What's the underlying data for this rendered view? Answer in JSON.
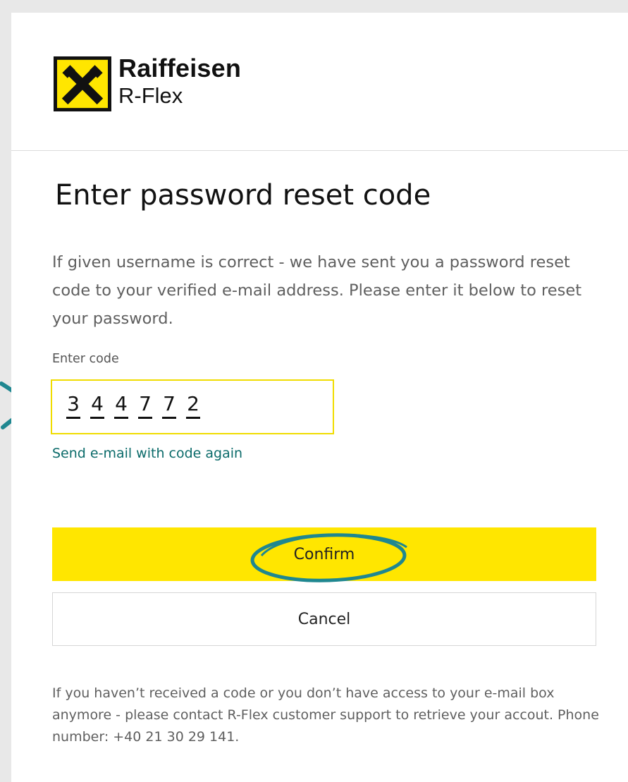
{
  "brand": {
    "name": "Raiffeisen",
    "product": "R-Flex",
    "mark_icon": "raiffeisen-gable-cross-icon",
    "accent_color": "#ffe600"
  },
  "page": {
    "title": "Enter password reset code",
    "intro": "If given username is correct - we have sent you a password reset code to your verified e-mail address. Please enter it below to reset your password."
  },
  "form": {
    "code_label": "Enter code",
    "code_digits": [
      "3",
      "4",
      "4",
      "7",
      "7",
      "2"
    ],
    "resend_link": "Send e-mail with code again",
    "confirm_label": "Confirm",
    "cancel_label": "Cancel"
  },
  "footer": {
    "note": "If you haven’t received a code or you don’t have access to your e-mail box anymore - please contact R-Flex customer support to retrieve your accout. Phone number: +40 21 30 29 141."
  },
  "annotations": {
    "color": "#1f8790"
  }
}
